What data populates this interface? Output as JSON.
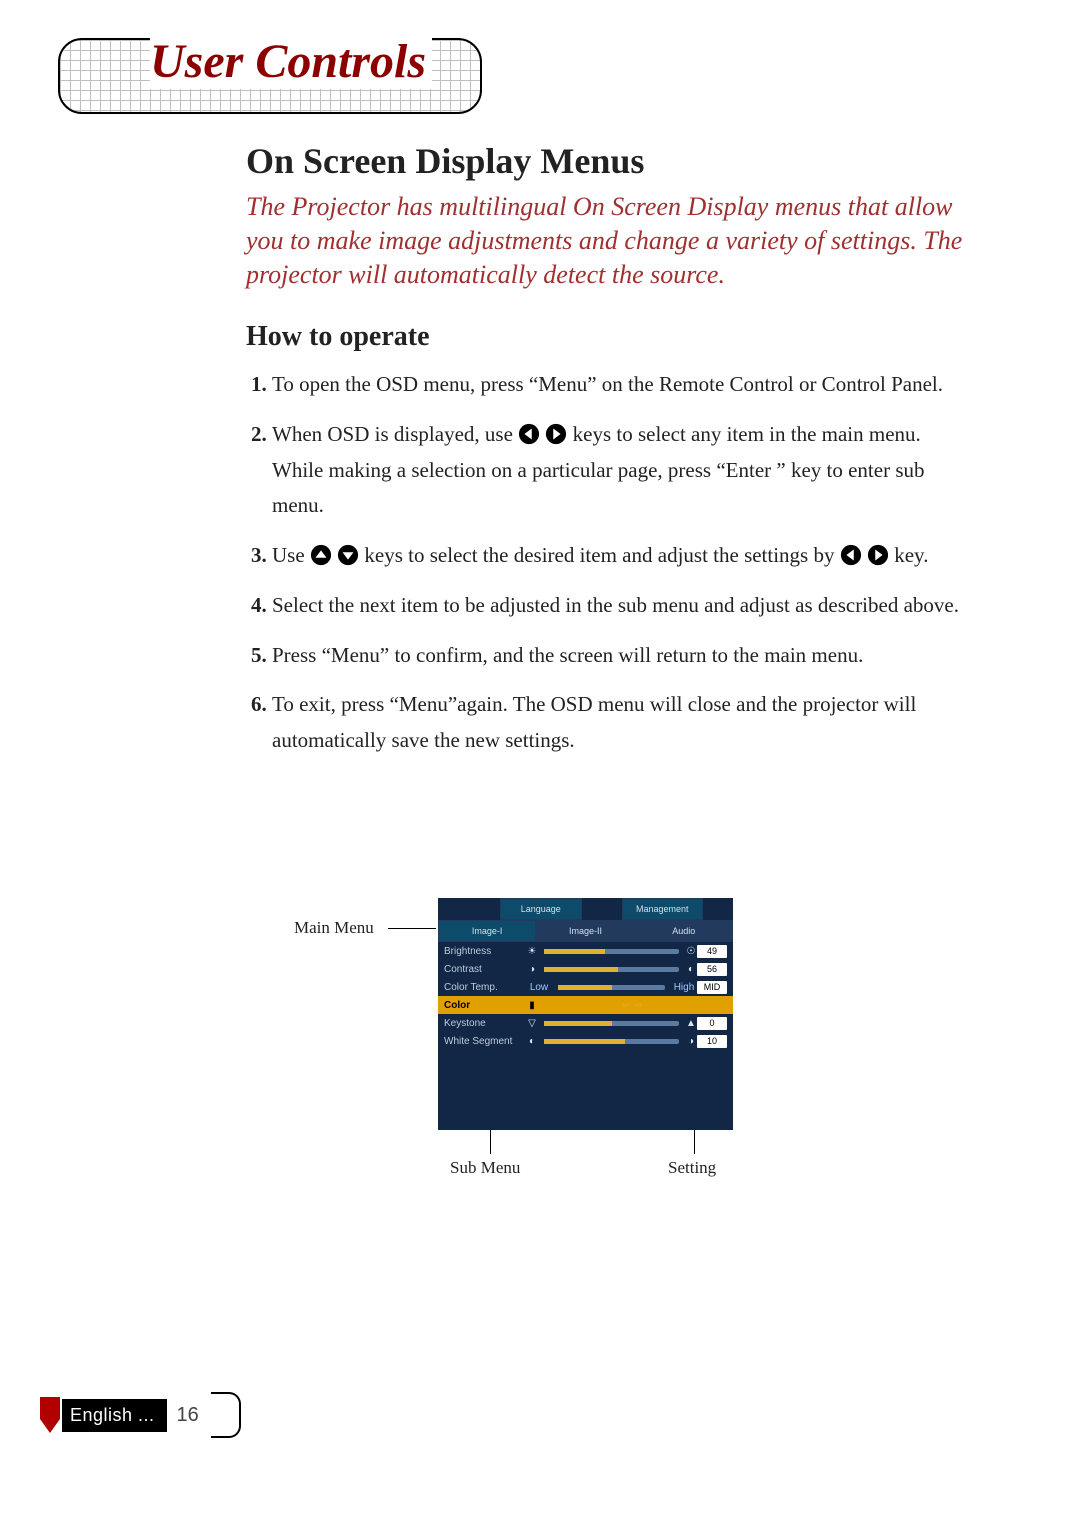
{
  "section_banner": "User Controls",
  "heading": "On Screen Display Menus",
  "intro": "The Projector has multilingual On Screen Display menus that allow you to make image adjustments and change a variety of settings. The projector will automatically detect the source.",
  "subheading": "How to operate",
  "steps": {
    "s1": "To open the OSD menu, press “Menu” on the Remote Control or Control Panel.",
    "s2a": "When OSD is displayed, use ",
    "s2b": " keys to select any item in the main menu.  While making a selection on a particular page, press “Enter ” key to enter sub menu.",
    "s3a": "Use ",
    "s3b": " keys to select the desired item and adjust the settings by ",
    "s3c": " key.",
    "s4": "Select the next item to be adjusted in the sub menu and adjust as described above.",
    "s5": "Press “Menu” to confirm, and the screen will return to the main menu.",
    "s6": "To exit, press “Menu”again.  The OSD menu will close and the projector will automatically save the new settings."
  },
  "diagram_labels": {
    "main_menu": "Main Menu",
    "sub_menu": "Sub Menu",
    "setting": "Setting"
  },
  "osd": {
    "top_tabs": [
      "Language",
      "Management"
    ],
    "mid_tabs": [
      "Image-I",
      "Image-II",
      "Audio"
    ],
    "selected_tab": "Image-I",
    "rows": [
      {
        "name": "Brightness",
        "icon_l": "☀",
        "icon_r": "☉",
        "value": "49"
      },
      {
        "name": "Contrast",
        "icon_l": "◑",
        "icon_r": "◐",
        "value": "56"
      },
      {
        "name": "Color Temp.",
        "left_text": "Low",
        "right_text": "High",
        "value": "MID"
      },
      {
        "name": "Color",
        "special": "lr"
      },
      {
        "name": "Keystone",
        "icon_l": "▽",
        "icon_r": "▲",
        "value": "0"
      },
      {
        "name": "White Segment",
        "icon_l": "◐",
        "icon_r": "◑",
        "value": "10"
      }
    ],
    "selected_row": "Color"
  },
  "footer": {
    "language": "English ...",
    "page": "16"
  }
}
